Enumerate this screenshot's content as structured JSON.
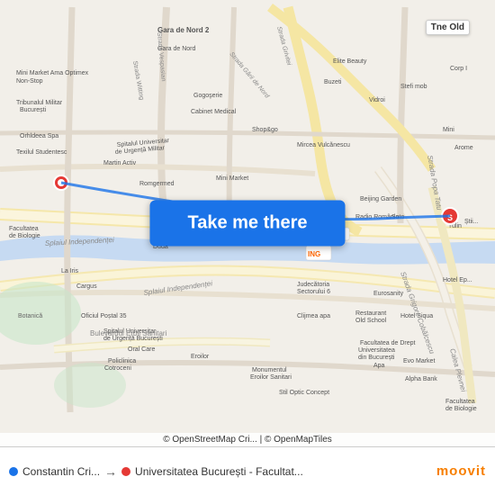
{
  "map": {
    "attribution": "© OpenStreetMap Cri... | © OpenMapTiles",
    "take_me_there": "Take me there",
    "old_kitchen_label": "Tne Old"
  },
  "bottom": {
    "from_label": "Constantin Cri...",
    "to_label": "Universitatea București - Facultat...",
    "arrow": "→",
    "moovit": "moovit"
  },
  "colors": {
    "blue": "#1a73e8",
    "red": "#e53935",
    "orange": "#f77f00",
    "map_bg": "#f2efe9",
    "road_yellow": "#f5e6a3",
    "road_white": "#ffffff",
    "water": "#b3d1f5"
  }
}
